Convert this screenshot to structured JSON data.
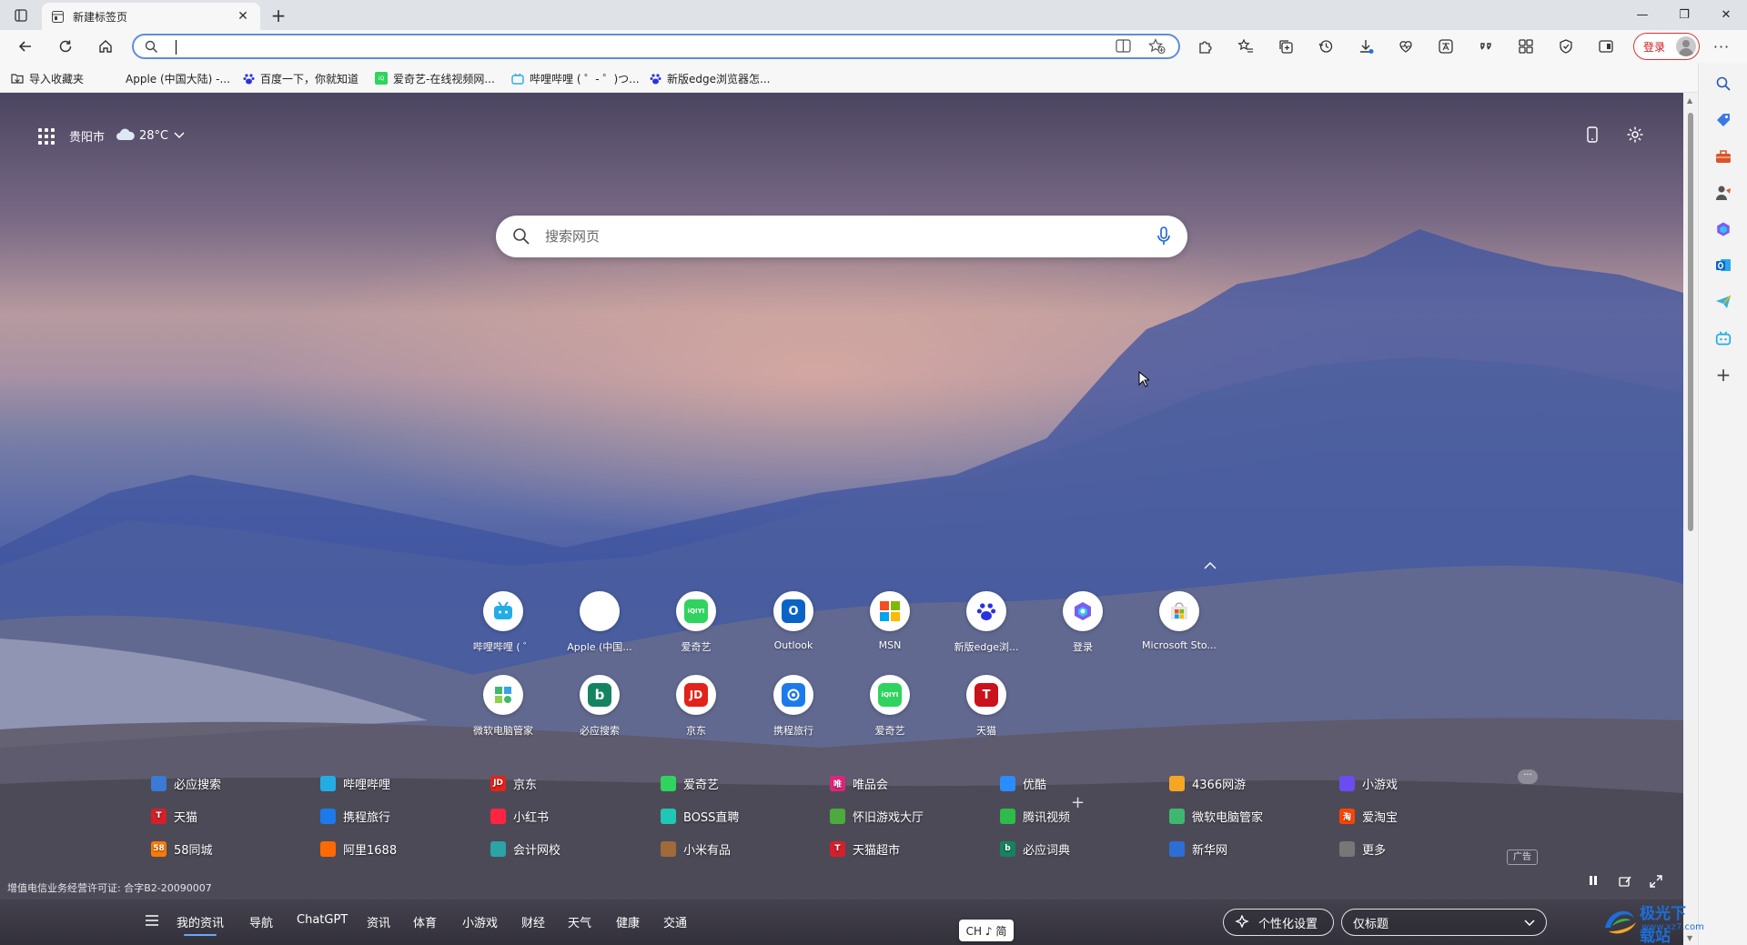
{
  "tabs": [
    {
      "title": "新建标签页"
    }
  ],
  "address_bar": {
    "value": ""
  },
  "toolbar": {
    "login_label": "登录"
  },
  "favorites": [
    {
      "label": "导入收藏夹",
      "icon": "folder-icon"
    },
    {
      "label": "Apple (中国大陆) -...",
      "icon": "apple-icon"
    },
    {
      "label": "百度一下，你就知道",
      "icon": "baidu-icon"
    },
    {
      "label": "爱奇艺-在线视频网...",
      "icon": "iqiyi-icon"
    },
    {
      "label": "哔哩哔哩 ( ゜- ゜)つ...",
      "icon": "bilibili-icon"
    },
    {
      "label": "新版edge浏览器怎...",
      "icon": "baidu-icon"
    }
  ],
  "weather": {
    "city": "贵阳市",
    "temp": "28°C"
  },
  "search": {
    "placeholder": "搜索网页"
  },
  "quick_links": [
    {
      "label": "哔哩哔哩 ( ゜",
      "color": "#23ade5",
      "text": ""
    },
    {
      "label": "Apple (中国...",
      "color": "#111111",
      "text": ""
    },
    {
      "label": "爱奇艺",
      "color": "#2fd35e",
      "text": "iQIYI"
    },
    {
      "label": "Outlook",
      "color": "#0a64c8",
      "text": "O"
    },
    {
      "label": "MSN",
      "color": "#ffffff",
      "text": ""
    },
    {
      "label": "新版edge浏...",
      "color": "#2f6bef",
      "text": ""
    },
    {
      "label": "登录",
      "color": "#7b5cf5",
      "text": ""
    },
    {
      "label": "Microsoft Sto...",
      "color": "#e6e6e6",
      "text": ""
    },
    {
      "label": "微软电脑管家",
      "color": "#3fb86f",
      "text": ""
    },
    {
      "label": "必应搜索",
      "color": "#13845f",
      "text": "b"
    },
    {
      "label": "京东",
      "color": "#e2231a",
      "text": "JD"
    },
    {
      "label": "携程旅行",
      "color": "#1c7aeb",
      "text": ""
    },
    {
      "label": "爱奇艺",
      "color": "#2fd35e",
      "text": "iQIYI"
    },
    {
      "label": "天猫",
      "color": "#c9121b",
      "text": "T"
    }
  ],
  "nav_links": [
    [
      {
        "label": "必应搜索",
        "color": "#3a7bd5",
        "text": ""
      },
      {
        "label": "天猫",
        "color": "#d3202a",
        "text": "T"
      },
      {
        "label": "58同城",
        "color": "#ff7a00",
        "text": "58"
      }
    ],
    [
      {
        "label": "哔哩哔哩",
        "color": "#23ade5",
        "text": ""
      },
      {
        "label": "携程旅行",
        "color": "#1c7aeb",
        "text": ""
      },
      {
        "label": "阿里1688",
        "color": "#ff6a00",
        "text": ""
      }
    ],
    [
      {
        "label": "京东",
        "color": "#e2231a",
        "text": "JD"
      },
      {
        "label": "小红书",
        "color": "#ff2442",
        "text": ""
      },
      {
        "label": "会计网校",
        "color": "#2aa4a6",
        "text": ""
      }
    ],
    [
      {
        "label": "爱奇艺",
        "color": "#2fd35e",
        "text": ""
      },
      {
        "label": "BOSS直聘",
        "color": "#1fc7b4",
        "text": ""
      },
      {
        "label": "小米有品",
        "color": "#a06a3a",
        "text": ""
      }
    ],
    [
      {
        "label": "唯品会",
        "color": "#e0237e",
        "text": "唯"
      },
      {
        "label": "怀旧游戏大厅",
        "color": "#4caa3e",
        "text": ""
      },
      {
        "label": "天猫超市",
        "color": "#d3202a",
        "text": "T"
      }
    ],
    [
      {
        "label": "优酷",
        "color": "#2b8cff",
        "text": ""
      },
      {
        "label": "腾讯视频",
        "color": "#2dbb4a",
        "text": ""
      },
      {
        "label": "必应词典",
        "color": "#13845f",
        "text": "b"
      }
    ],
    [
      {
        "label": "4366网游",
        "color": "#f5a623",
        "text": ""
      },
      {
        "label": "微软电脑管家",
        "color": "#3fb86f",
        "text": ""
      },
      {
        "label": "新华网",
        "color": "#2b6fd6",
        "text": ""
      }
    ],
    [
      {
        "label": "小游戏",
        "color": "#6a4cf0",
        "text": ""
      },
      {
        "label": "爱淘宝",
        "color": "#ff4400",
        "text": "淘"
      },
      {
        "label": "更多",
        "color": "#777777",
        "text": ""
      }
    ]
  ],
  "ad_label": "广告",
  "license": "增值电信业务经营许可证: 合字B2-20090007",
  "bottom_nav": {
    "items": [
      "我的资讯",
      "导航",
      "ChatGPT",
      "资讯",
      "体育",
      "小游戏",
      "财经",
      "天气",
      "健康",
      "交通"
    ],
    "active_index": 0
  },
  "ime": "CH ♪ 简",
  "personalize_label": "个性化设置",
  "layout_select": {
    "value": "仅标题"
  },
  "watermark": {
    "title": "极光下载站",
    "sub": "www.xz7.com"
  }
}
